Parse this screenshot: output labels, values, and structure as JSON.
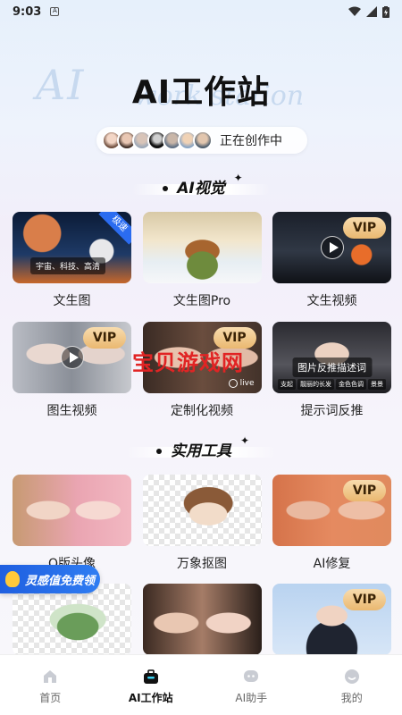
{
  "status_bar": {
    "time": "9:03",
    "notification_icon": "A"
  },
  "hero": {
    "title": "AI工作站",
    "bg_text": "AI",
    "bg_text_sub": "work station"
  },
  "creating": {
    "label": "正在创作中"
  },
  "sections": [
    {
      "title": "AI视觉",
      "items": [
        {
          "label": "文生图",
          "badge": "极速",
          "overlay": "宇宙、科技、高清"
        },
        {
          "label": "文生图Pro"
        },
        {
          "label": "文生视频",
          "badge": "VIP"
        },
        {
          "label": "图生视频",
          "badge": "VIP"
        },
        {
          "label": "定制化视频",
          "badge": "VIP",
          "overlay": "live"
        },
        {
          "label": "提示词反推",
          "overlay": "图片反推描述词",
          "tags": [
            "支起",
            "靓丽的长发",
            "金色色调",
            "景景"
          ]
        }
      ]
    },
    {
      "title": "实用工具",
      "items": [
        {
          "label": "Q版头像"
        },
        {
          "label": "万象抠图"
        },
        {
          "label": "AI修复",
          "badge": "VIP"
        },
        {
          "label": ""
        },
        {
          "label": ""
        },
        {
          "label": "",
          "badge": "VIP"
        }
      ]
    }
  ],
  "watermark": "宝贝游戏网",
  "promo": {
    "label": "灵感值免费领"
  },
  "tabbar": [
    {
      "label": "首页",
      "icon": "home-icon",
      "active": false
    },
    {
      "label": "AI工作站",
      "icon": "briefcase-icon",
      "active": true
    },
    {
      "label": "AI助手",
      "icon": "assistant-icon",
      "active": false
    },
    {
      "label": "我的",
      "icon": "profile-icon",
      "active": false
    }
  ],
  "colors": {
    "accent": "#2b6cf0",
    "vip_gold": "#eab870",
    "watermark": "#e12424"
  }
}
